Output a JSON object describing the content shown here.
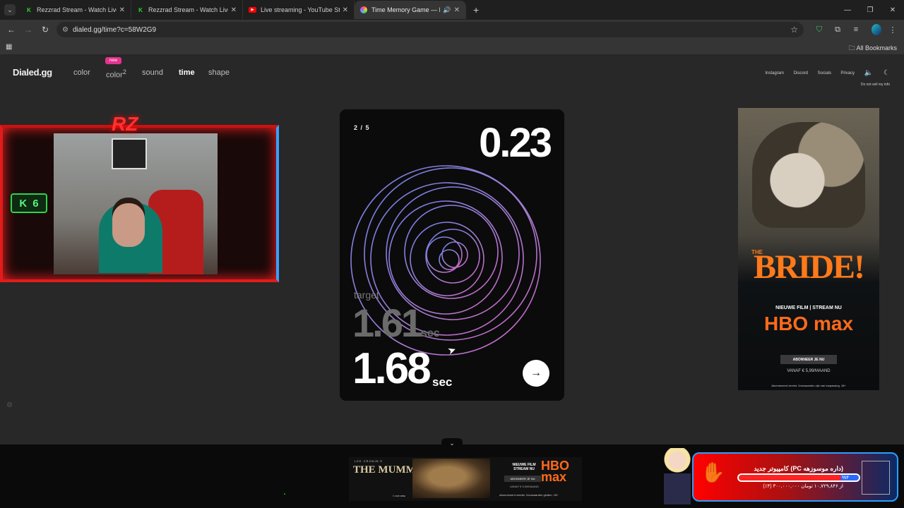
{
  "browser": {
    "tabs": [
      {
        "title": "Rezzrad Stream - Watch Live on",
        "favicon": "kick-icon",
        "active": false
      },
      {
        "title": "Rezzrad Stream - Watch Live on",
        "favicon": "kick-icon",
        "active": false
      },
      {
        "title": "Live streaming - YouTube Studio",
        "favicon": "youtube-icon",
        "active": false
      },
      {
        "title": "Time Memory Game — How",
        "favicon": "dialed-icon",
        "active": true
      }
    ],
    "url": "dialed.gg/time?c=58W2G9",
    "bookmarks_label": "All Bookmarks"
  },
  "site": {
    "logo": "Dialed.gg",
    "nav": [
      {
        "label": "color",
        "active": false
      },
      {
        "label": "color",
        "sup": "2",
        "active": false,
        "badge": "new"
      },
      {
        "label": "sound",
        "active": false
      },
      {
        "label": "time",
        "active": true
      },
      {
        "label": "shape",
        "active": false
      }
    ],
    "right_links": [
      "Instagram",
      "Discord",
      "Socials",
      "Privacy"
    ],
    "do_not_sell": "Do not sell my info"
  },
  "game": {
    "round": "2 / 5",
    "score": "0.23",
    "target_label": "target",
    "target_value": "1.61",
    "target_unit": "sec",
    "result_value": "1.68",
    "result_unit": "sec",
    "next_icon": "arrow-right-icon"
  },
  "webcam": {
    "overlay_logo": "RZ",
    "kick_count": "6"
  },
  "ad_right": {
    "title_pre": "THE",
    "title": "BRIDE!",
    "tagline": "NIEUWE FILM | STREAM NU",
    "brand": "HBO max",
    "cta": "ABONNEER JE NU",
    "price": "VANAF € 5,99/MAAND",
    "fine": "Abonnement vereist. Voorwaarden zijn van toepassing. 18+"
  },
  "ad_bottom": {
    "pre": "LEE CRONIN'S",
    "title": "THE MUMMY",
    "tag": "NIEUWE FILM STREAM NU",
    "brand": "HBO max",
    "cta": "ABONNEER JE NU",
    "price": "VANAF € 5,99/MAAND",
    "fine": "Abonnement vereist. Voorwaarden gelden. 18+",
    "date": "© 2026 WBEI"
  },
  "ad_persian": {
    "line1": "کامپیوتر جدید (PC داره موسوزهه)",
    "percent": "%۴",
    "line2": "از ۱۰,۷۲۹,۸۴۶ تومان ۳۰۰,۰۰۰,۰۰۰ (۴٪)"
  }
}
